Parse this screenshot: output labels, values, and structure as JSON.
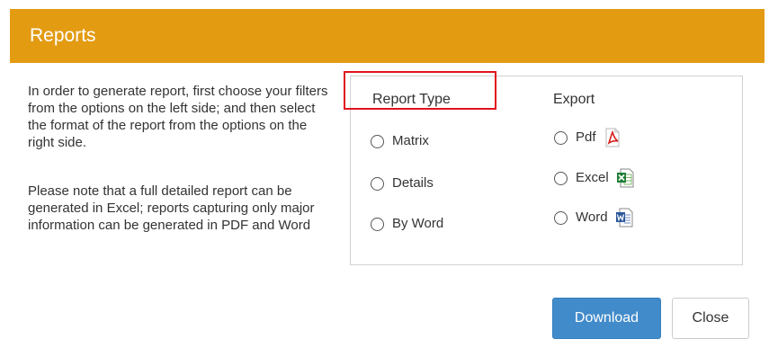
{
  "dialog": {
    "title": "Reports",
    "header_color": "#e39b12",
    "intro_paragraph_1": "In order to generate report, first choose your filters from the options on the left side; and then select the format of the report from the options on the right side.",
    "intro_paragraph_2": "Please note that a full detailed report can be generated in Excel; reports capturing only major information can be generated in PDF and Word"
  },
  "report_type": {
    "heading": "Report Type",
    "options": [
      {
        "label": "Matrix",
        "selected": false
      },
      {
        "label": "Details",
        "selected": false
      },
      {
        "label": "By Word",
        "selected": false
      }
    ]
  },
  "export": {
    "heading": "Export",
    "options": [
      {
        "label": "Pdf",
        "icon": "pdf-file-icon",
        "selected": false
      },
      {
        "label": "Excel",
        "icon": "excel-file-icon",
        "selected": false
      },
      {
        "label": "Word",
        "icon": "word-file-icon",
        "selected": false
      }
    ]
  },
  "buttons": {
    "download_label": "Download",
    "close_label": "Close",
    "primary_color": "#428bca"
  },
  "annotation": {
    "highlight_color": "#e0121b"
  }
}
